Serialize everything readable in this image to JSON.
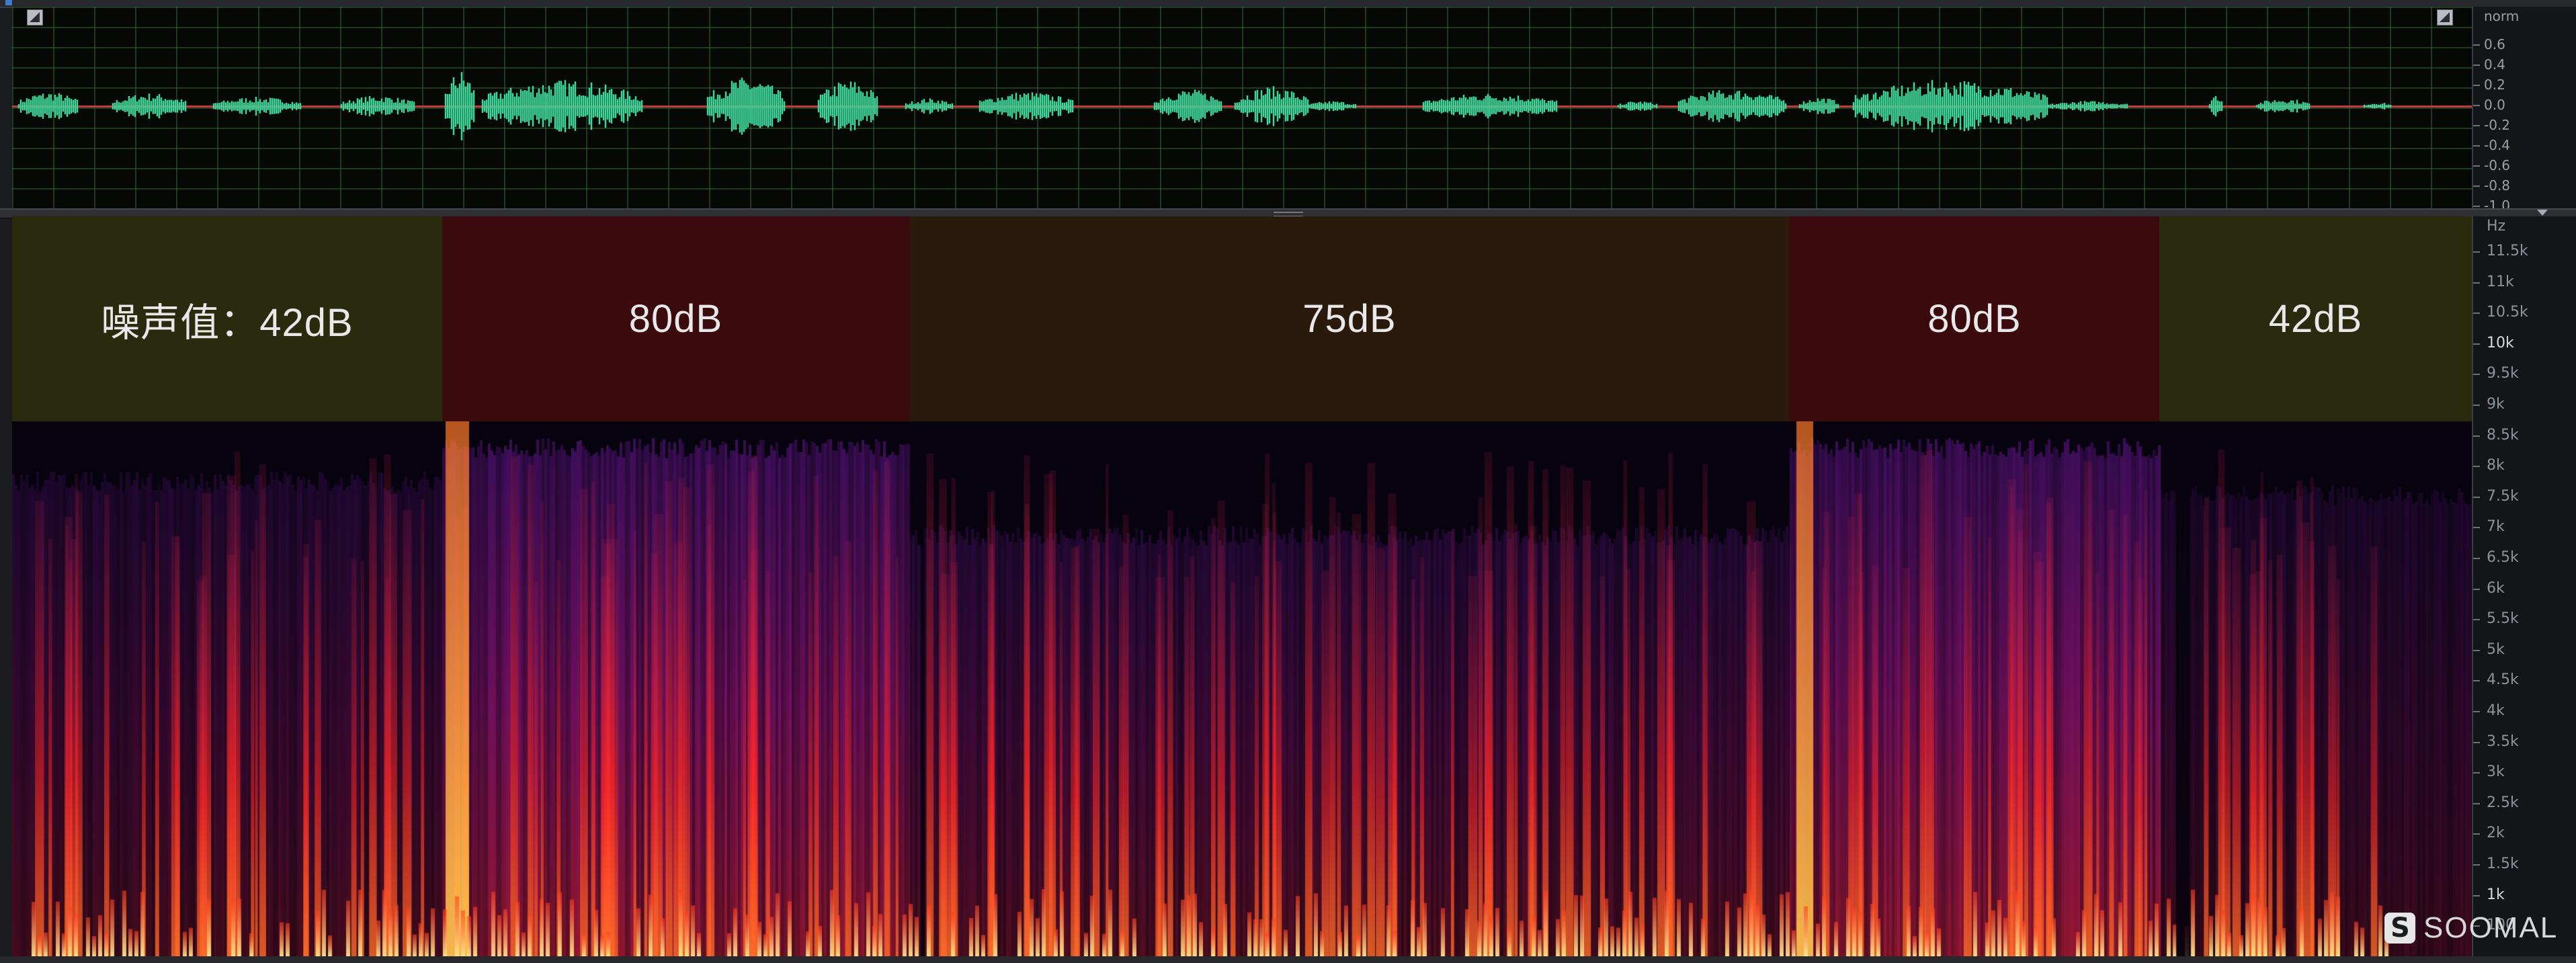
{
  "waveform": {
    "scale_title": "norm",
    "scale_labels": [
      "0.6",
      "0.4",
      "0.2",
      "0.0",
      "-0.2",
      "-0.4",
      "-0.6",
      "-0.8",
      "-1.0"
    ],
    "color": "#3fd49a",
    "centerline_color": "#c23b3b"
  },
  "spectrogram": {
    "unit_label": "Hz",
    "freq_labels": [
      {
        "label": "11.5k",
        "major": false
      },
      {
        "label": "11k",
        "major": false
      },
      {
        "label": "10.5k",
        "major": false
      },
      {
        "label": "10k",
        "major": true
      },
      {
        "label": "9.5k",
        "major": false
      },
      {
        "label": "9k",
        "major": false
      },
      {
        "label": "8.5k",
        "major": false
      },
      {
        "label": "8k",
        "major": false
      },
      {
        "label": "7.5k",
        "major": false
      },
      {
        "label": "7k",
        "major": false
      },
      {
        "label": "6.5k",
        "major": false
      },
      {
        "label": "6k",
        "major": false
      },
      {
        "label": "5.5k",
        "major": false
      },
      {
        "label": "5k",
        "major": false
      },
      {
        "label": "4.5k",
        "major": false
      },
      {
        "label": "4k",
        "major": false
      },
      {
        "label": "3.5k",
        "major": false
      },
      {
        "label": "3k",
        "major": false
      },
      {
        "label": "2.5k",
        "major": false
      },
      {
        "label": "2k",
        "major": false
      },
      {
        "label": "1.5k",
        "major": false
      },
      {
        "label": "1k",
        "major": true
      },
      {
        "label": "100",
        "major": false
      }
    ],
    "noise_bands": [
      {
        "label": "噪声值：42dB",
        "level": "low"
      },
      {
        "label": "80dB",
        "level": "high"
      },
      {
        "label": "75dB",
        "level": "mid"
      },
      {
        "label": "80dB",
        "level": "high"
      },
      {
        "label": "42dB",
        "level": "low"
      }
    ],
    "colors": {
      "low_band": "#2a2a0e",
      "high_band": "#3a0a0d",
      "mid_band": "#2a1a0c",
      "hot": "#ff2a2a",
      "warm": "#8b1aa0",
      "peak": "#ffe38a"
    }
  },
  "watermark": {
    "text": "SOOMAL",
    "icon": "soomal-logo-icon"
  }
}
